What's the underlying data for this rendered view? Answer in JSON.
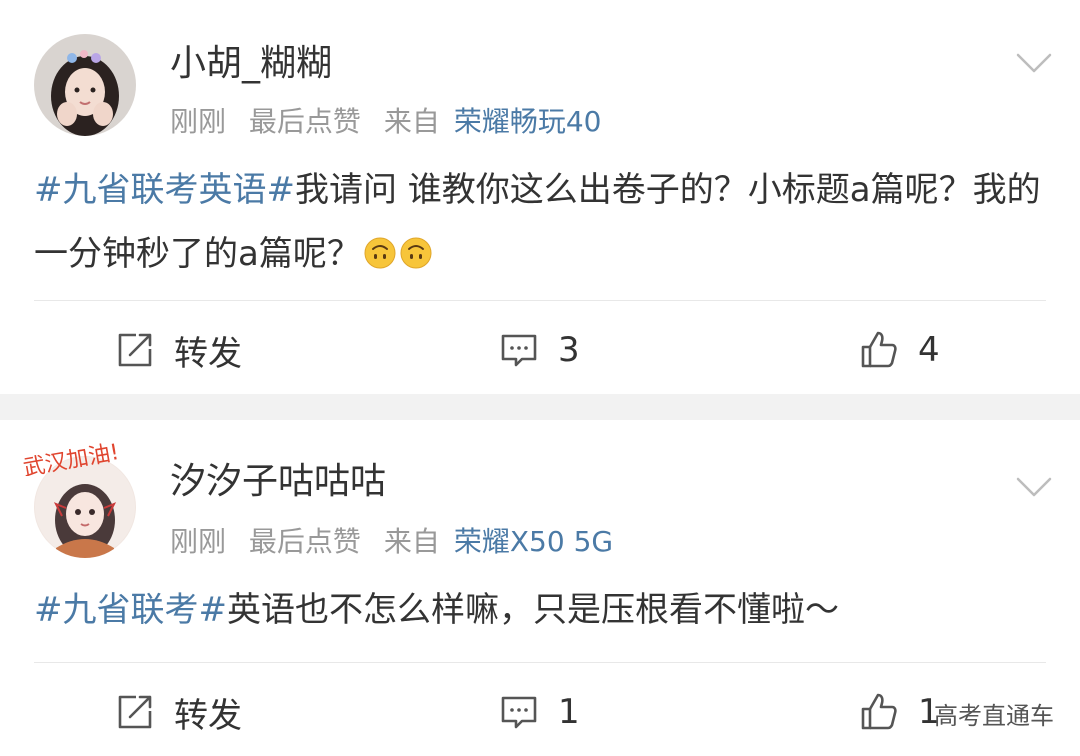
{
  "posts": [
    {
      "username": "小胡_糊糊",
      "time": "刚刚",
      "status": "最后点赞",
      "source_prefix": "来自",
      "device": "荣耀畅玩40",
      "tag": "#九省联考英语#",
      "text": "我请问 谁教你这么出卷子的？小标题a篇呢？我的一分钟秒了的a篇呢？",
      "emoji": [
        "upside-down-face",
        "upside-down-face"
      ],
      "repost_label": "转发",
      "comment_count": "3",
      "like_count": "4"
    },
    {
      "username": "汐汐子咕咕咕",
      "time": "刚刚",
      "status": "最后点赞",
      "source_prefix": "来自",
      "device": "荣耀X50 5G",
      "tag": "#九省联考#",
      "text": "英语也不怎么样嘛，只是压根看不懂啦～",
      "repost_label": "转发",
      "comment_count": "1",
      "like_count": "1",
      "avatar_badge_text": "武汉加油!"
    }
  ],
  "watermark": "高考直通车",
  "colors": {
    "link": "#4b7aa6",
    "meta": "#999999",
    "text": "#333333",
    "separator": "#f2f2f2"
  },
  "icons": [
    "chevron-down-icon",
    "repost-icon",
    "comment-icon",
    "like-icon"
  ]
}
